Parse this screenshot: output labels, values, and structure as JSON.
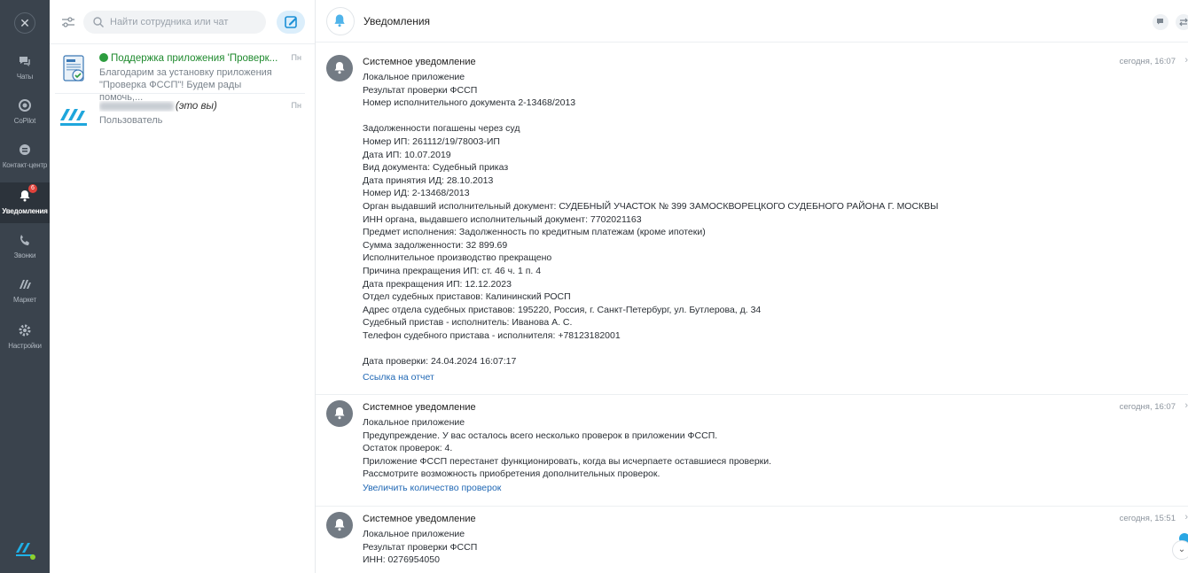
{
  "nav": {
    "close_icon": "close-icon",
    "items": [
      {
        "label": "Чаты",
        "icon": "chat-icon"
      },
      {
        "label": "CoPilot",
        "icon": "copilot-icon"
      },
      {
        "label": "Контакт-центр",
        "icon": "contact-center-icon"
      },
      {
        "label": "Уведомления",
        "icon": "bell-icon",
        "badge": "6"
      },
      {
        "label": "Звонки",
        "icon": "phone-icon"
      },
      {
        "label": "Маркет",
        "icon": "market-icon"
      },
      {
        "label": "Настройки",
        "icon": "gear-icon"
      }
    ]
  },
  "list": {
    "search_placeholder": "Найти сотрудника или чат",
    "chats": [
      {
        "name": "Поддержка приложения 'Проверк...",
        "date": "Пн",
        "preview": "Благодарим за установку приложения \"Проверка ФССП\"! Будем рады помочь,..."
      },
      {
        "name_suffix": "(это вы)",
        "date": "Пн",
        "preview": "Пользователь"
      }
    ]
  },
  "main": {
    "title": "Уведомления",
    "messages": [
      {
        "title": "Системное уведомление",
        "time": "сегодня, 16:07",
        "body": "Локальное приложение\nРезультат проверки ФССП\nНомер исполнительного документа 2-13468/2013\n\nЗадолженности погашены через суд\nНомер ИП: 261112/19/78003-ИП\nДата ИП: 10.07.2019\nВид документа: Судебный приказ\nДата принятия ИД: 28.10.2013\nНомер ИД: 2-13468/2013\nОрган выдавший исполнительный документ: СУДЕБНЫЙ УЧАСТОК № 399 ЗАМОСКВОРЕЦКОГО СУДЕБНОГО РАЙОНА Г. МОСКВЫ\nИНН органа, выдавшего исполнительный документ: 7702021163\nПредмет исполнения: Задолженность по кредитным платежам (кроме ипотеки)\nСумма задолженности: 32 899.69\nИсполнительное производство прекращено\nПричина прекращения ИП: ст. 46 ч. 1 п. 4\nДата прекращения ИП: 12.12.2023\nОтдел судебных приставов: Калининский РОСП\nАдрес отдела судебных приставов: 195220, Россия, г. Санкт-Петербург, ул. Бутлерова, д. 34\nСудебный пристав - исполнитель: Иванова А. С.\nТелефон судебного пристава - исполнителя: +78123182001\n\nДата проверки: 24.04.2024 16:07:17",
        "link": "Ссылка на отчет"
      },
      {
        "title": "Системное уведомление",
        "time": "сегодня, 16:07",
        "body": "Локальное приложение\nПредупреждение. У вас осталось всего несколько проверок в приложении ФССП.\nОстаток проверок: 4.\nПриложение ФССП перестанет функционировать, когда вы исчерпаете оставшиеся проверки.\nРассмотрите возможность приобретения дополнительных проверок.",
        "link": "Увеличить количество проверок"
      },
      {
        "title": "Системное уведомление",
        "time": "сегодня, 15:51",
        "body": "Локальное приложение\nРезультат проверки ФССП\nИНН: 0276954050",
        "link": ""
      }
    ]
  }
}
